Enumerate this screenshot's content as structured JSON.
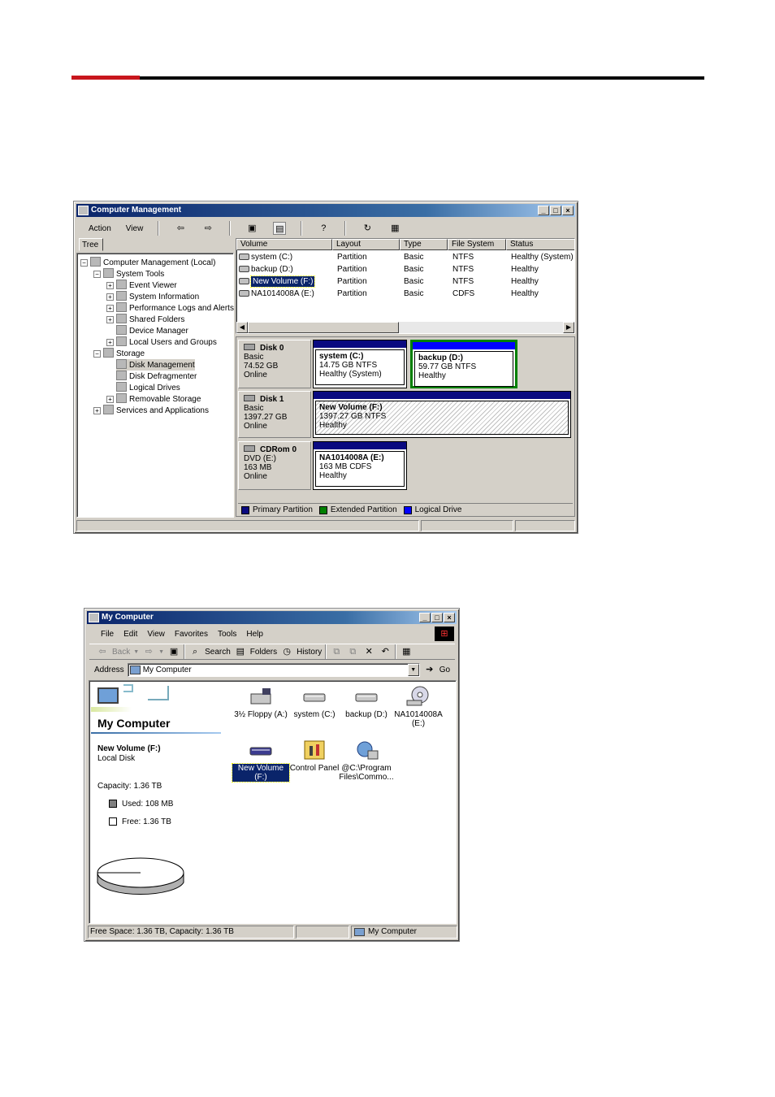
{
  "cm": {
    "title": "Computer Management",
    "menu": [
      "Action",
      "View"
    ],
    "tree_tab": "Tree",
    "tree": [
      {
        "label": "Computer Management (Local)",
        "level": 0
      },
      {
        "label": "System Tools",
        "level": 1
      },
      {
        "label": "Event Viewer",
        "level": 2
      },
      {
        "label": "System Information",
        "level": 2
      },
      {
        "label": "Performance Logs and Alerts",
        "level": 2
      },
      {
        "label": "Shared Folders",
        "level": 2
      },
      {
        "label": "Device Manager",
        "level": 2
      },
      {
        "label": "Local Users and Groups",
        "level": 2
      },
      {
        "label": "Storage",
        "level": 1
      },
      {
        "label": "Disk Management",
        "level": 2
      },
      {
        "label": "Disk Defragmenter",
        "level": 2
      },
      {
        "label": "Logical Drives",
        "level": 2
      },
      {
        "label": "Removable Storage",
        "level": 2
      },
      {
        "label": "Services and Applications",
        "level": 1
      }
    ],
    "columns": [
      "Volume",
      "Layout",
      "Type",
      "File System",
      "Status"
    ],
    "volumes": [
      {
        "volume": "system (C:)",
        "layout": "Partition",
        "type": "Basic",
        "fs": "NTFS",
        "status": "Healthy (System)"
      },
      {
        "volume": "backup (D:)",
        "layout": "Partition",
        "type": "Basic",
        "fs": "NTFS",
        "status": "Healthy"
      },
      {
        "volume": "New Volume (F:)",
        "layout": "Partition",
        "type": "Basic",
        "fs": "NTFS",
        "status": "Healthy"
      },
      {
        "volume": "NA1014008A (E:)",
        "layout": "Partition",
        "type": "Basic",
        "fs": "CDFS",
        "status": "Healthy"
      }
    ],
    "disks": [
      {
        "name": "Disk 0",
        "kind": "Basic",
        "size": "74.52 GB",
        "state": "Online",
        "parts": [
          {
            "name": "system  (C:)",
            "size": "14.75 GB NTFS",
            "status": "Healthy (System)"
          },
          {
            "name": "backup  (D:)",
            "size": "59.77 GB NTFS",
            "status": "Healthy"
          }
        ]
      },
      {
        "name": "Disk 1",
        "kind": "Basic",
        "size": "1397.27 GB",
        "state": "Online",
        "parts": [
          {
            "name": "New Volume  (F:)",
            "size": "1397.27 GB NTFS",
            "status": "Healthy"
          }
        ]
      },
      {
        "name": "CDRom 0",
        "kind": "DVD (E:)",
        "size": "163 MB",
        "state": "Online",
        "parts": [
          {
            "name": "NA1014008A  (E:)",
            "size": "163 MB CDFS",
            "status": "Healthy"
          }
        ]
      }
    ],
    "legend": [
      {
        "label": "Primary Partition",
        "color": "#0a0a80"
      },
      {
        "label": "Extended Partition",
        "color": "#008000"
      },
      {
        "label": "Logical Drive",
        "color": "#0000ff"
      }
    ]
  },
  "mc": {
    "title": "My Computer",
    "menu": [
      "File",
      "Edit",
      "View",
      "Favorites",
      "Tools",
      "Help"
    ],
    "toolbar": {
      "back": "Back",
      "search": "Search",
      "folders": "Folders",
      "history": "History"
    },
    "address_label": "Address",
    "address_value": "My Computer",
    "go": "Go",
    "panel_title": "My Computer",
    "selected_name": "New Volume (F:)",
    "selected_type": "Local Disk",
    "capacity": "Capacity: 1.36 TB",
    "used": "Used: 108 MB",
    "free": "Free: 1.36 TB",
    "used_fraction": 0.0001,
    "icons": [
      {
        "label": "3½ Floppy (A:)",
        "icon": "floppy-drive-icon"
      },
      {
        "label": "system (C:)",
        "icon": "hard-drive-icon"
      },
      {
        "label": "backup (D:)",
        "icon": "hard-drive-icon"
      },
      {
        "label": "NA1014008A (E:)",
        "icon": "cd-drive-icon"
      },
      {
        "label": "New Volume (F:)",
        "icon": "hard-drive-icon"
      },
      {
        "label": "Control Panel",
        "icon": "control-panel-icon"
      },
      {
        "label": "@C:\\Program Files\\Commo...",
        "icon": "network-folder-icon"
      }
    ],
    "status_left": "Free Space: 1.36 TB, Capacity: 1.36 TB",
    "status_right": "My Computer"
  }
}
